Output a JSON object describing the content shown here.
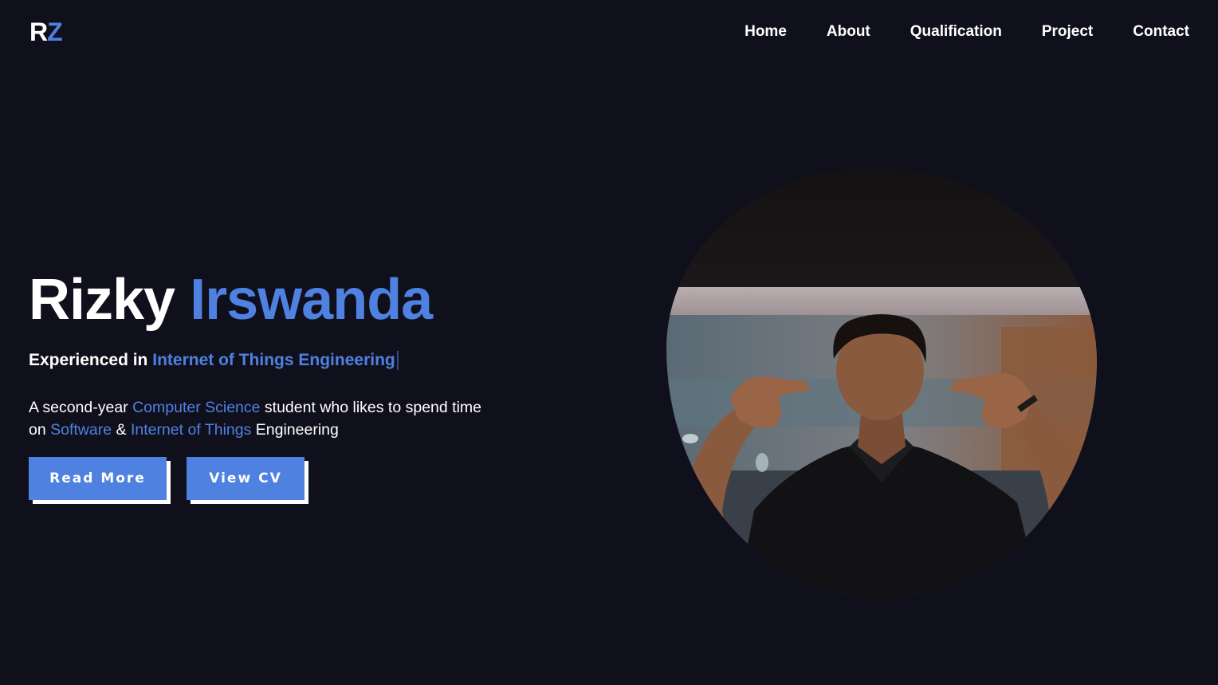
{
  "header": {
    "logo_part1": "R",
    "logo_part2": "Z",
    "nav": [
      {
        "label": "Home"
      },
      {
        "label": "About"
      },
      {
        "label": "Qualification"
      },
      {
        "label": "Project"
      },
      {
        "label": "Contact"
      }
    ]
  },
  "hero": {
    "first_name": "Rizky",
    "last_name": "Irswanda",
    "tagline_prefix": "Experienced in",
    "tagline_highlight": "Internet of Things Engineering",
    "desc": {
      "p1": "A second-year",
      "h1": "Computer Science",
      "p2": "student who likes to spend time on",
      "h2": "Software",
      "p3": "&",
      "h3": "Internet of Things",
      "p4": "Engineering"
    },
    "buttons": {
      "read_more": "Read More",
      "view_cv": "View CV"
    }
  },
  "colors": {
    "background": "#10101d",
    "accent": "#4f81e0",
    "text": "#ffffff"
  },
  "icons": {
    "photo": "profile-photo"
  }
}
